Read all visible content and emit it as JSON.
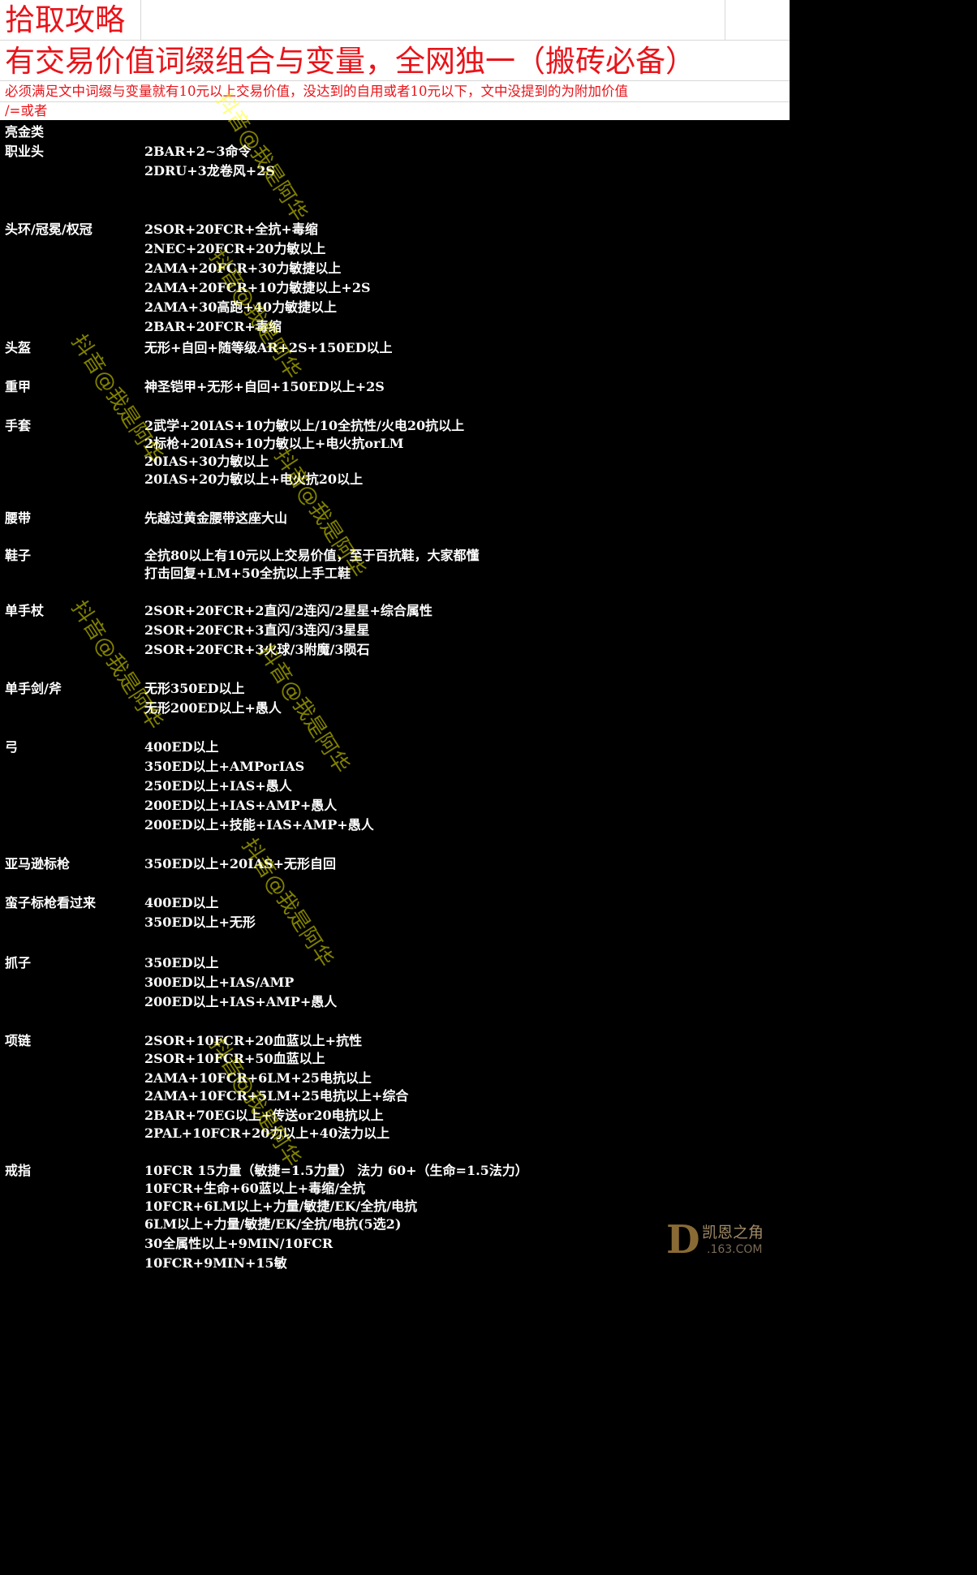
{
  "header": {
    "title": "拾取攻略",
    "subtitle": "有交易价值词缀组合与变量，全网独一（搬砖必备）",
    "note_line1": "必须满足文中词缀与变量就有10元以上交易价值，没达到的自用或者10元以下，文中没提到的为附加价值",
    "note_line2": "/=或者"
  },
  "rows": [
    {
      "cat": "亮金类",
      "val": ""
    },
    {
      "cat": "职业头",
      "val": "2BAR+2~3命令"
    },
    {
      "cat": "",
      "val": "2DRU+3龙卷风+2S"
    },
    {
      "cat": "头环/冠冕/权冠",
      "val": "2SOR+20FCR+全抗+毒缩"
    },
    {
      "cat": "",
      "val": "2NEC+20FCR+20力敏以上"
    },
    {
      "cat": "",
      "val": "2AMA+20FCR+30力敏捷以上"
    },
    {
      "cat": "",
      "val": "2AMA+20FCR+10力敏捷以上+2S"
    },
    {
      "cat": "",
      "val": "2AMA+30高跑+40力敏捷以上"
    },
    {
      "cat": "",
      "val": "2BAR+20FCR+毒缩"
    },
    {
      "cat": "头盔",
      "val": "无形+自回+随等级AR+2S+150ED以上"
    },
    {
      "cat": "重甲",
      "val": "神圣铠甲+无形+自回+150ED以上+2S"
    },
    {
      "cat": "手套",
      "val": "2武学+20IAS+10力敏以上/10全抗性/火电20抗以上"
    },
    {
      "cat": "",
      "val": "2标枪+20IAS+10力敏以上+电火抗orLM"
    },
    {
      "cat": "",
      "val": "20IAS+30力敏以上"
    },
    {
      "cat": "",
      "val": "20IAS+20力敏以上+电火抗20以上"
    },
    {
      "cat": "腰带",
      "val": "先越过黄金腰带这座大山"
    },
    {
      "cat": "鞋子",
      "val": "全抗80以上有10元以上交易价值，至于百抗鞋，大家都懂"
    },
    {
      "cat": "",
      "val": "打击回复+LM+50全抗以上手工鞋"
    },
    {
      "cat": "单手杖",
      "val": "2SOR+20FCR+2直闪/2连闪/2星星+综合属性"
    },
    {
      "cat": "",
      "val": "2SOR+20FCR+3直闪/3连闪/3星星"
    },
    {
      "cat": "",
      "val": "2SOR+20FCR+3火球/3附魔/3陨石"
    },
    {
      "cat": "单手剑/斧",
      "val": "无形350ED以上"
    },
    {
      "cat": "",
      "val": "无形200ED以上+愚人"
    },
    {
      "cat": "弓",
      "val": "400ED以上"
    },
    {
      "cat": "",
      "val": "350ED以上+AMPorIAS"
    },
    {
      "cat": "",
      "val": "250ED以上+IAS+愚人"
    },
    {
      "cat": "",
      "val": "200ED以上+IAS+AMP+愚人"
    },
    {
      "cat": "",
      "val": "200ED以上+技能+IAS+AMP+愚人"
    },
    {
      "cat": "亚马逊标枪",
      "val": "350ED以上+20IAS+无形自回"
    },
    {
      "cat": "蛮子标枪看过来",
      "val": "400ED以上"
    },
    {
      "cat": "",
      "val": "350ED以上+无形"
    },
    {
      "cat": "抓子",
      "val": "350ED以上"
    },
    {
      "cat": "",
      "val": "300ED以上+IAS/AMP"
    },
    {
      "cat": "",
      "val": "200ED以上+IAS+AMP+愚人"
    },
    {
      "cat": "项链",
      "val": "2SOR+10FCR+20血蓝以上+抗性"
    },
    {
      "cat": "",
      "val": "2SOR+10FCR+50血蓝以上"
    },
    {
      "cat": "",
      "val": "2AMA+10FCR+6LM+25电抗以上"
    },
    {
      "cat": "",
      "val": "2AMA+10FCR+5LM+25电抗以上+综合"
    },
    {
      "cat": "",
      "val": "2BAR+70EG以上+传送or20电抗以上"
    },
    {
      "cat": "",
      "val": "2PAL+10FCR+20力以上+40法力以上"
    },
    {
      "cat": "戒指",
      "val": "10FCR 15力量（敏捷=1.5力量） 法力 60+（生命=1.5法力）"
    },
    {
      "cat": "",
      "val": "10FCR+生命+60蓝以上+毒缩/全抗"
    },
    {
      "cat": "",
      "val": "10FCR+6LM以上+力量/敏捷/EK/全抗/电抗"
    },
    {
      "cat": "",
      "val": "6LM以上+力量/敏捷/EK/全抗/电抗(5选2)"
    },
    {
      "cat": "",
      "val": "30全属性以上+9MIN/10FCR"
    },
    {
      "cat": "",
      "val": "10FCR+9MIN+15敏"
    }
  ],
  "watermark": "抖音@我是阿华",
  "logo": {
    "mark": "D",
    "name": "凯恩之角",
    "domain": ".163.COM"
  },
  "colors": {
    "header_text": "#e8141a",
    "header_bg": "#ffffff",
    "body_bg": "#000000",
    "body_text": "#ffffff",
    "watermark": "#ffff00"
  }
}
